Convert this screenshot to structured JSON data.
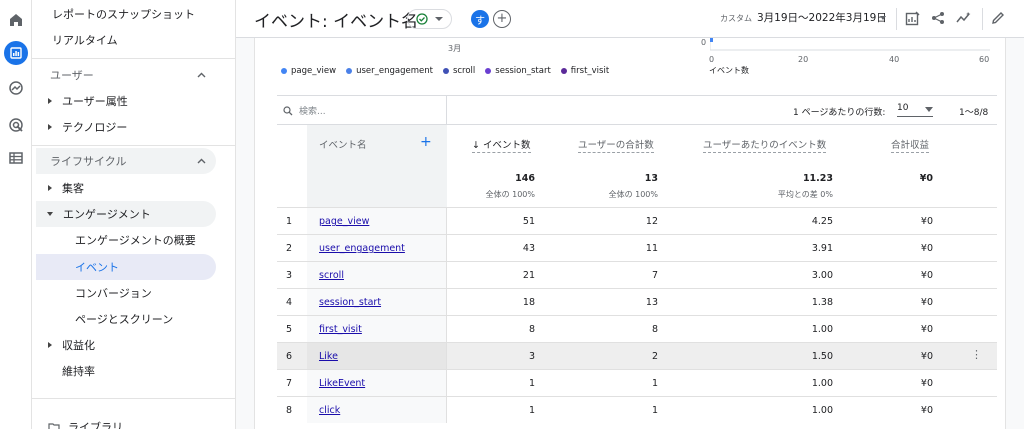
{
  "sidebar": {
    "snapshot": "レポートのスナップショット",
    "realtime": "リアルタイム",
    "section_user": "ユーザー",
    "user_attr": "ユーザー属性",
    "technology": "テクノロジー",
    "section_lifecycle": "ライフサイクル",
    "acquisition": "集客",
    "engagement": "エンゲージメント",
    "engagement_overview": "エンゲージメントの概要",
    "events": "イベント",
    "conversions": "コンバージョン",
    "pages_screens": "ページとスクリーン",
    "monetization": "収益化",
    "retention": "維持率",
    "library": "ライブラリ"
  },
  "header": {
    "title": "イベント: イベント名",
    "avatar_letter": "す",
    "add_compare": "+",
    "date_label": "カスタム",
    "date_range": "3月19日〜2022年3月19日"
  },
  "chart_fragments": {
    "left_tick": "3月",
    "right_tick_zero": "0",
    "x_ticks": [
      "0",
      "20",
      "40",
      "60"
    ],
    "x_axis_label": "イベント数"
  },
  "legend": [
    {
      "name": "page_view",
      "color": "#4285f4"
    },
    {
      "name": "user_engagement",
      "color": "#4a80e8"
    },
    {
      "name": "scroll",
      "color": "#3f51b5"
    },
    {
      "name": "session_start",
      "color": "#6a3fd1"
    },
    {
      "name": "first_visit",
      "color": "#5b2a99"
    }
  ],
  "table": {
    "search_placeholder": "検索...",
    "rows_per_page_label": "1 ページあたりの行数:",
    "rows_per_page": "10",
    "range": "1〜8/8",
    "headers": {
      "dimension": "イベント名",
      "event_count": "イベント数",
      "total_users": "ユーザーの合計数",
      "events_per_user": "ユーザーあたりのイベント数",
      "revenue": "合計収益"
    },
    "totals": {
      "event_count": "146",
      "event_count_sub": "全体の 100%",
      "total_users": "13",
      "total_users_sub": "全体の 100%",
      "events_per_user": "11.23",
      "events_per_user_sub": "平均との差 0%",
      "revenue": "¥0"
    },
    "rows": [
      {
        "idx": "1",
        "name": "page_view",
        "events": "51",
        "users": "12",
        "per_user": "4.25",
        "revenue": "¥0"
      },
      {
        "idx": "2",
        "name": "user_engagement",
        "events": "43",
        "users": "11",
        "per_user": "3.91",
        "revenue": "¥0"
      },
      {
        "idx": "3",
        "name": "scroll",
        "events": "21",
        "users": "7",
        "per_user": "3.00",
        "revenue": "¥0"
      },
      {
        "idx": "4",
        "name": "session_start",
        "events": "18",
        "users": "13",
        "per_user": "1.38",
        "revenue": "¥0"
      },
      {
        "idx": "5",
        "name": "first_visit",
        "events": "8",
        "users": "8",
        "per_user": "1.00",
        "revenue": "¥0"
      },
      {
        "idx": "6",
        "name": "Like",
        "events": "3",
        "users": "2",
        "per_user": "1.50",
        "revenue": "¥0"
      },
      {
        "idx": "7",
        "name": "LikeEvent",
        "events": "1",
        "users": "1",
        "per_user": "1.00",
        "revenue": "¥0"
      },
      {
        "idx": "8",
        "name": "click",
        "events": "1",
        "users": "1",
        "per_user": "1.00",
        "revenue": "¥0"
      }
    ]
  }
}
